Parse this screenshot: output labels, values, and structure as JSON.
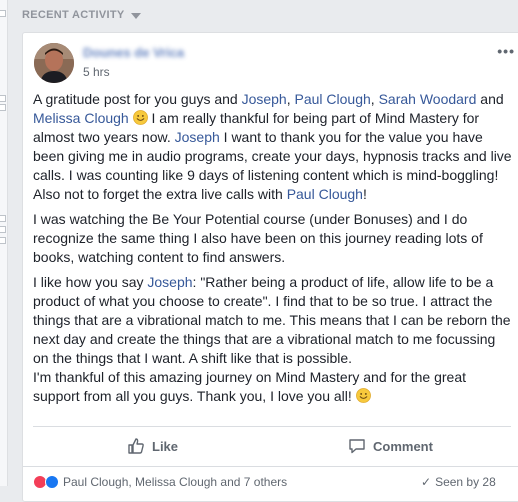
{
  "section": {
    "title": "RECENT ACTIVITY"
  },
  "post": {
    "author": "Dounes de Vrica",
    "time": "5 hrs",
    "paragraphs": [
      [
        {
          "t": "A gratitude post for you guys and "
        },
        {
          "t": "Joseph",
          "m": true
        },
        {
          "t": ", "
        },
        {
          "t": "Paul Clough",
          "m": true
        },
        {
          "t": ", "
        },
        {
          "t": "Sarah Woodard",
          "m": true
        },
        {
          "t": " and "
        },
        {
          "t": "Melissa Clough",
          "m": true
        },
        {
          "t": " "
        },
        {
          "e": "smile"
        },
        {
          "t": " I am really thankful for being part of Mind Mastery for almost two years now. "
        },
        {
          "t": "Joseph",
          "m": true
        },
        {
          "t": " I want to thank you for the value you have been giving me in audio programs, create your days, hypnosis tracks and live calls. I was counting like 9 days of listening content which is mind-boggling! Also not to forget the extra live calls with "
        },
        {
          "t": "Paul Clough",
          "m": true
        },
        {
          "t": "!"
        }
      ],
      [
        {
          "t": "I was watching the Be Your Potential course (under Bonuses) and I do recognize the same thing I also have been on this journey reading lots of books, watching content to find answers."
        }
      ],
      [
        {
          "t": "I like how you say "
        },
        {
          "t": "Joseph",
          "m": true
        },
        {
          "t": ": \"Rather being a product of life, allow life to be a product of what you choose to create\". I find that to be so true. I attract the things that are a vibrational match to me. This means that I can be reborn the next day and create the things that are a vibrational match to me focussing on the things that I want. A shift like that is possible."
        },
        {
          "br": true
        },
        {
          "t": "I'm thankful of this amazing journey on Mind Mastery and for the great support from all you guys. Thank you, I love you all! "
        },
        {
          "e": "smile"
        }
      ]
    ]
  },
  "actions": {
    "like": "Like",
    "comment": "Comment"
  },
  "footer": {
    "reactions_text": "Paul Clough, Melissa Clough and 7 others",
    "seen_text": "Seen by 28"
  },
  "colors": {
    "link": "#365899",
    "accent": "#4267b2"
  }
}
